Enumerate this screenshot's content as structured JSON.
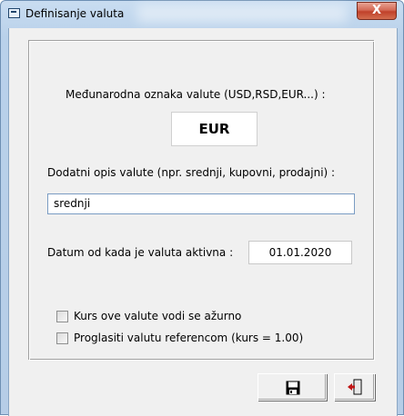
{
  "window": {
    "title": "Definisanje valuta",
    "close_label": "X"
  },
  "form": {
    "intl_code_label": "Međunarodna oznaka valute (USD,RSD,EUR...) :",
    "intl_code_value": "EUR",
    "description_label": "Dodatni opis valute (npr. srednji, kupovni, prodajni) :",
    "description_value": "srednji",
    "date_label": "Datum od kada je valuta aktivna :",
    "date_value": "01.01.2020",
    "checkboxes": [
      {
        "label": "Kurs ove valute vodi se ažurno",
        "checked": false
      },
      {
        "label": "Proglasiti valutu referencom (kurs = 1.00)",
        "checked": false
      }
    ]
  },
  "buttons": {
    "save_icon": "floppy-disk-icon",
    "exit_icon": "exit-door-icon"
  }
}
